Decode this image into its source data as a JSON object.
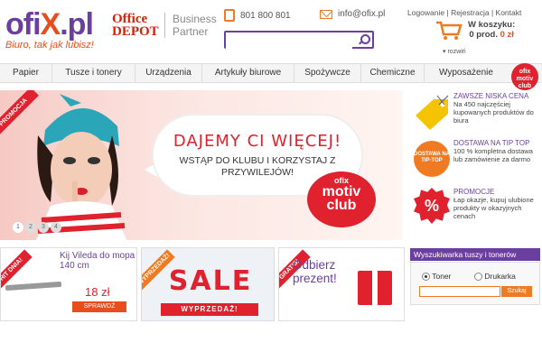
{
  "header": {
    "logo_main": "ofi",
    "logo_x": "X",
    "logo_tld": ".pl",
    "slogan": "Biuro, tak jak lubisz!",
    "office_depot": "Office DEPOT",
    "partner": "Business Partner",
    "phone": "801 800 801",
    "email": "info@ofix.pl",
    "search_placeholder": "",
    "links": [
      "Logowanie",
      "Rejestracja",
      "Kontakt"
    ],
    "cart_label": "W koszyku:",
    "cart_count": "0 prod.",
    "cart_total": "0 zł",
    "cart_expand": "rozwiń"
  },
  "nav": [
    {
      "label": "Papier"
    },
    {
      "label": "Tusze i tonery"
    },
    {
      "label": "Urządzenia"
    },
    {
      "label": "Artykuły biurowe"
    },
    {
      "label": "Spożywcze"
    },
    {
      "label": "Chemiczne"
    },
    {
      "label": "Wyposażenie"
    }
  ],
  "motiv_badge": "ofix motiv club",
  "banner": {
    "ribbon": "PROMOCJA",
    "headline": "DAJEMY CI WIĘCEJ!",
    "text": "WSTĄP DO KLUBU I KORZYSTAJ Z PRZYWILEJÓW!",
    "club_ofix": "ofix",
    "club_motiv": "motiv",
    "club_club": "club",
    "slides": [
      "1",
      "2",
      "3",
      "4"
    ],
    "active_slide": 1
  },
  "side_promos": [
    {
      "title": "ZAWSZE NISKA CENA",
      "text": "Na 450 najczęściej kupowanych produktów do biura"
    },
    {
      "title": "DOSTAWA NA TIP TOP",
      "text": "100 % kompletna dostawa lub zamówienie za darmo",
      "badge": "DOSTAWA NA TIP-TOP"
    },
    {
      "title": "PROMOCJE",
      "text": "Łap okazje, kupuj ulubione produkty w okazyjnych cenach",
      "badge": "%"
    }
  ],
  "tiles": {
    "hit": {
      "ribbon": "HIT DNIA!",
      "name": "Kij Vileda do mopa 140 cm",
      "price": "18 zł",
      "button": "SPRAWDŹ"
    },
    "sale": {
      "ribbon": "WYPRZEDAŻ!",
      "title": "SALE",
      "subtitle": "WYPRZEDAŻ!"
    },
    "gift": {
      "ribbon": "GRATIS!",
      "line1": "Odbierz",
      "line2": "prezent!"
    }
  },
  "toner_search": {
    "title": "Wyszukiwarka tuszy i tonerów",
    "option_toner": "Toner",
    "option_printer": "Drukarka",
    "selected": "Toner",
    "button": "Szukaj"
  },
  "colors": {
    "brand": "#6b3fa0",
    "accent": "#e84e1b",
    "red": "#e0212e"
  }
}
